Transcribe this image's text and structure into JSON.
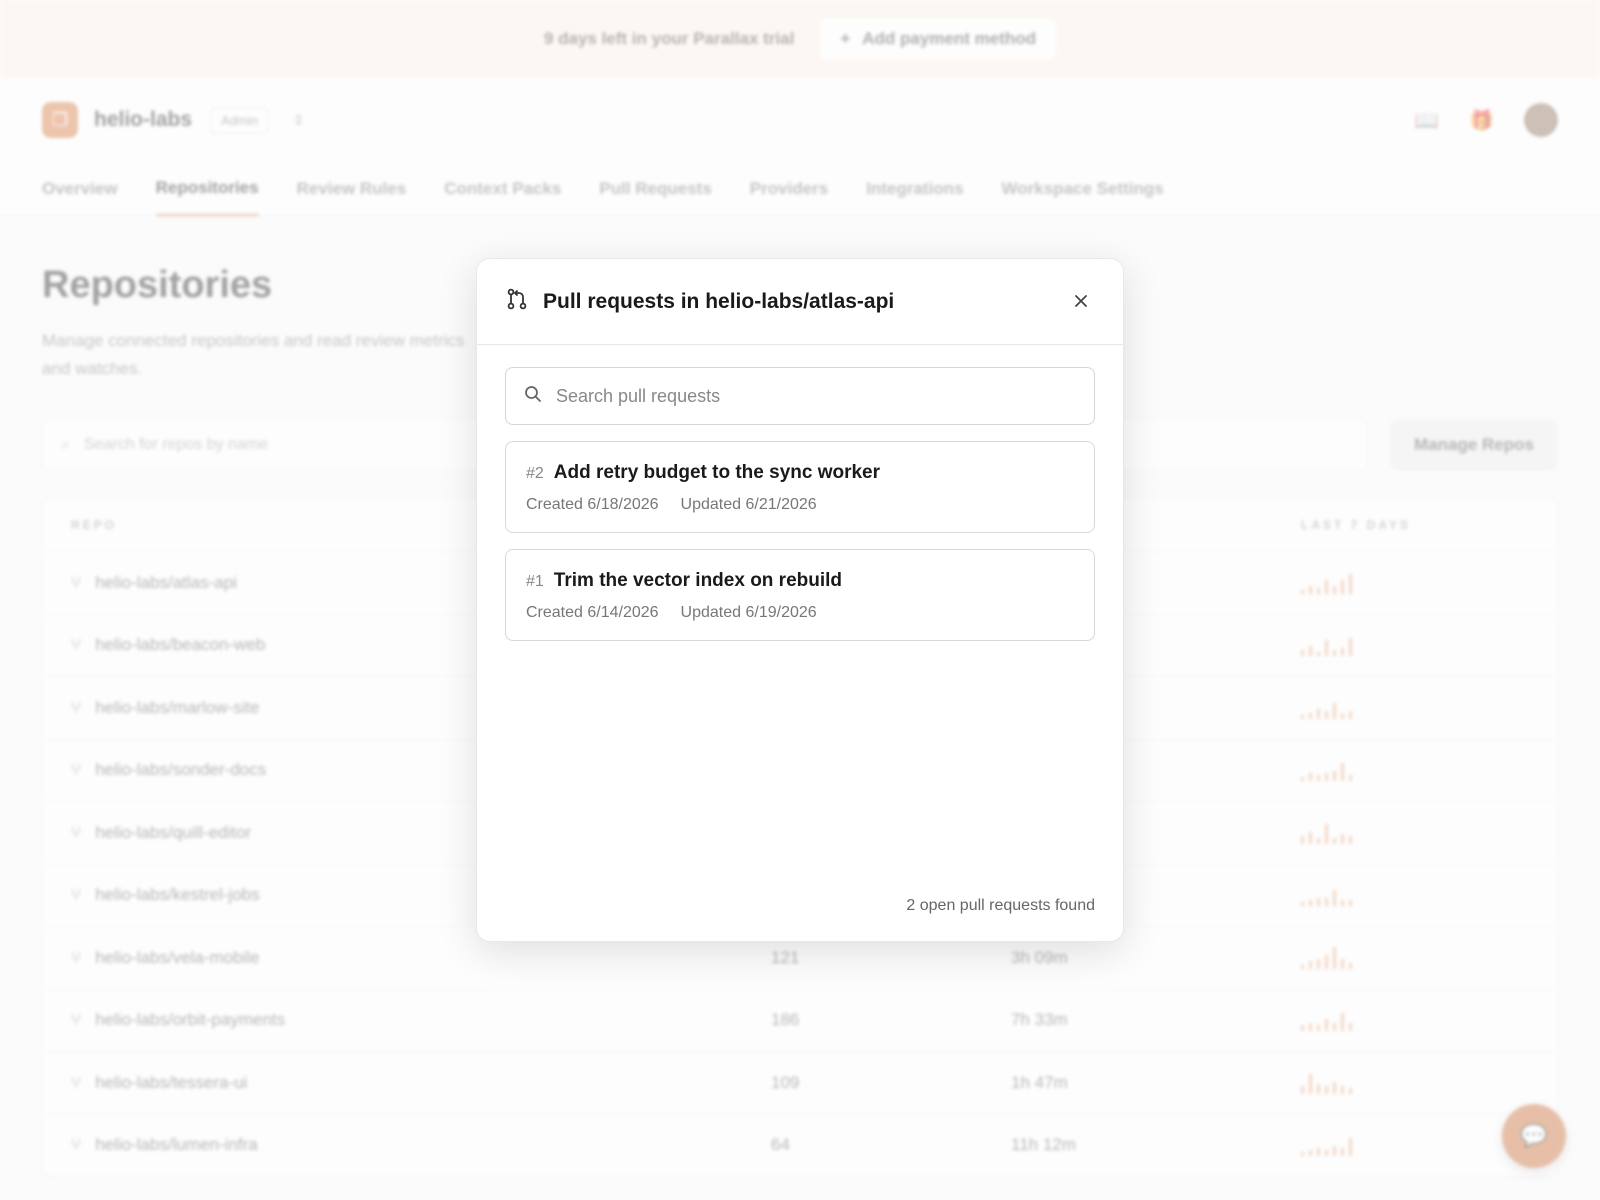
{
  "trial": {
    "text": "9 days left in your Parallax trial",
    "button_label": "Add payment method"
  },
  "header": {
    "org_name": "helio-labs",
    "role": "Admin"
  },
  "tabs": [
    {
      "label": "Overview"
    },
    {
      "label": "Repositories",
      "active": true
    },
    {
      "label": "Review Rules"
    },
    {
      "label": "Context Packs"
    },
    {
      "label": "Pull Requests"
    },
    {
      "label": "Providers"
    },
    {
      "label": "Integrations"
    },
    {
      "label": "Workspace Settings"
    }
  ],
  "page": {
    "title": "Repositories",
    "description": "Manage connected repositories and read review metrics and watches.",
    "search_placeholder": "Search for repos by name",
    "manage_label": "Manage Repos"
  },
  "table": {
    "col_repo": "REPO",
    "col_last7": "LAST 7 DAYS",
    "rows": [
      {
        "name": "helio-labs/atlas-api",
        "count": "",
        "time": "",
        "spark": [
          2,
          4,
          3,
          7,
          4,
          7,
          10
        ]
      },
      {
        "name": "helio-labs/beacon-web",
        "count": "",
        "time": "",
        "spark": [
          3,
          5,
          2,
          8,
          3,
          4,
          9
        ]
      },
      {
        "name": "helio-labs/marlow-site",
        "count": "",
        "time": "",
        "spark": [
          2,
          3,
          5,
          4,
          8,
          3,
          4
        ]
      },
      {
        "name": "helio-labs/sonder-docs",
        "count": "",
        "time": "",
        "spark": [
          2,
          4,
          3,
          4,
          5,
          9,
          3
        ]
      },
      {
        "name": "helio-labs/quill-editor",
        "count": "",
        "time": "",
        "spark": [
          4,
          6,
          3,
          10,
          3,
          5,
          4
        ]
      },
      {
        "name": "helio-labs/kestrel-jobs",
        "count": "",
        "time": "",
        "spark": [
          2,
          3,
          4,
          4,
          8,
          3,
          3
        ]
      },
      {
        "name": "helio-labs/vela-mobile",
        "count": "121",
        "time": "3h 09m",
        "spark": [
          2,
          4,
          5,
          7,
          11,
          5,
          3
        ]
      },
      {
        "name": "helio-labs/orbit-payments",
        "count": "186",
        "time": "7h 33m",
        "spark": [
          3,
          4,
          3,
          6,
          4,
          9,
          4
        ]
      },
      {
        "name": "helio-labs/tessera-ui",
        "count": "109",
        "time": "1h 47m",
        "spark": [
          4,
          10,
          5,
          4,
          6,
          4,
          3
        ]
      },
      {
        "name": "helio-labs/lumen-infra",
        "count": "64",
        "time": "11h 12m",
        "spark": [
          2,
          3,
          4,
          3,
          5,
          4,
          9
        ]
      }
    ]
  },
  "modal": {
    "title": "Pull requests in helio-labs/atlas-api",
    "search_placeholder": "Search pull requests",
    "pull_requests": [
      {
        "number": "#2",
        "title": "Add retry budget to the sync worker",
        "created": "Created 6/18/2026",
        "updated": "Updated 6/21/2026"
      },
      {
        "number": "#1",
        "title": "Trim the vector index on rebuild",
        "created": "Created 6/14/2026",
        "updated": "Updated 6/19/2026"
      }
    ],
    "footer": "2 open pull requests found"
  },
  "icons": {
    "pr": "git-pull-request-icon",
    "search": "search-icon",
    "close": "close-icon",
    "chat": "chat-icon"
  },
  "colors": {
    "accent": "#d9773c",
    "trial_bg": "#fdf1e8"
  }
}
